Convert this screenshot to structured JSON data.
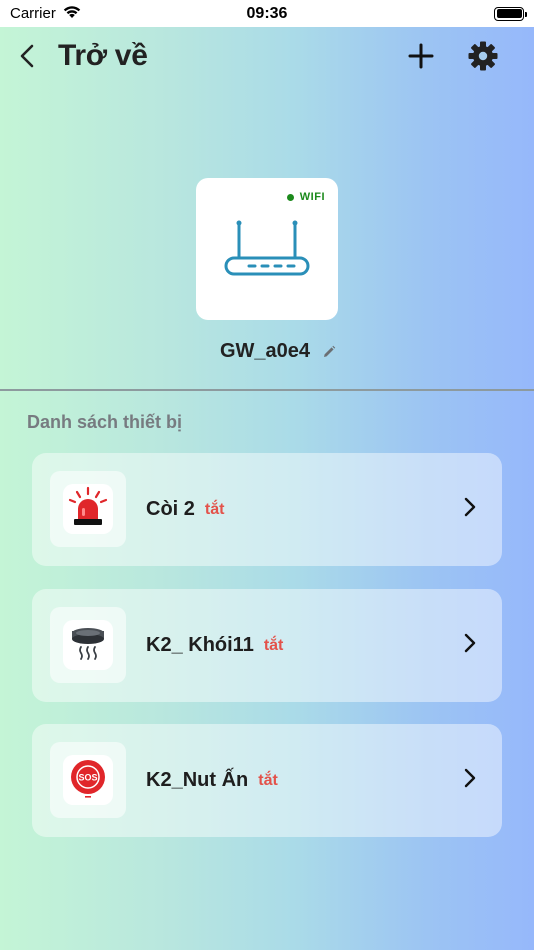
{
  "status_bar": {
    "carrier": "Carrier",
    "time": "09:36"
  },
  "nav": {
    "title": "Trở về"
  },
  "gateway": {
    "badge": "WIFI",
    "name": "GW_a0e4"
  },
  "section": {
    "title": "Danh sách thiết bị"
  },
  "devices": [
    {
      "name": "Còi 2",
      "status": "tắt",
      "icon": "siren-icon"
    },
    {
      "name": "K2_ Khói11",
      "status": "tắt",
      "icon": "smoke-detector-icon"
    },
    {
      "name": "K2_Nut Ấn",
      "status": "tắt",
      "icon": "sos-button-icon"
    }
  ],
  "icons": {
    "sos_text": "SOS"
  },
  "colors": {
    "status_off": "#e3524a",
    "wifi_online": "#1c8a1c",
    "router_line": "#2a8fb8"
  }
}
